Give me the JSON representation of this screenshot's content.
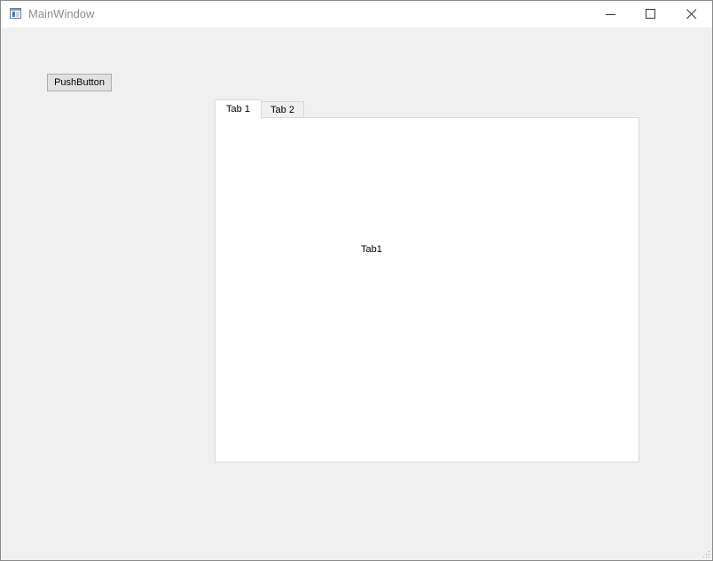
{
  "window": {
    "title": "MainWindow",
    "app_icon": "app-window-icon",
    "controls": {
      "minimize_icon": "minimize-icon",
      "maximize_icon": "maximize-icon",
      "close_icon": "close-icon"
    }
  },
  "main": {
    "push_button_label": "PushButton",
    "tabs": [
      {
        "label": "Tab 1",
        "selected": true
      },
      {
        "label": "Tab 2",
        "selected": false
      }
    ],
    "active_tab_content": "Tab1"
  },
  "colors": {
    "window_bg": "#f0f0f0",
    "titlebar_bg": "#ffffff",
    "title_text": "#8c8c8c",
    "panel_bg": "#ffffff",
    "border": "#d9d9d9"
  }
}
